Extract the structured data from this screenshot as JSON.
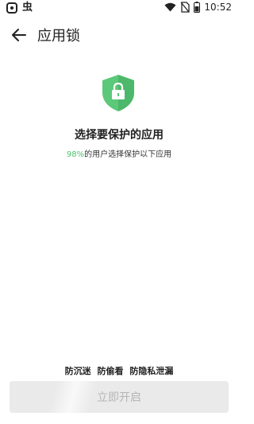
{
  "status_bar": {
    "time": "10:52",
    "icons": [
      "wifi-icon",
      "no-sim-icon",
      "battery-icon"
    ]
  },
  "header": {
    "back_icon": "arrow-left-icon",
    "title": "应用锁"
  },
  "hero": {
    "icon": "shield-lock-icon",
    "headline": "选择要保护的应用",
    "percent": "98%",
    "subline_rest": "的用户选择保护以下应用"
  },
  "features": [
    "防沉迷",
    "防偷看",
    "防隐私泄漏"
  ],
  "start_button": {
    "label": "立即开启"
  },
  "colors": {
    "accent_green": "#4cc26c",
    "button_disabled_bg": "#eaeaea",
    "button_disabled_text": "#b5b5b5"
  }
}
